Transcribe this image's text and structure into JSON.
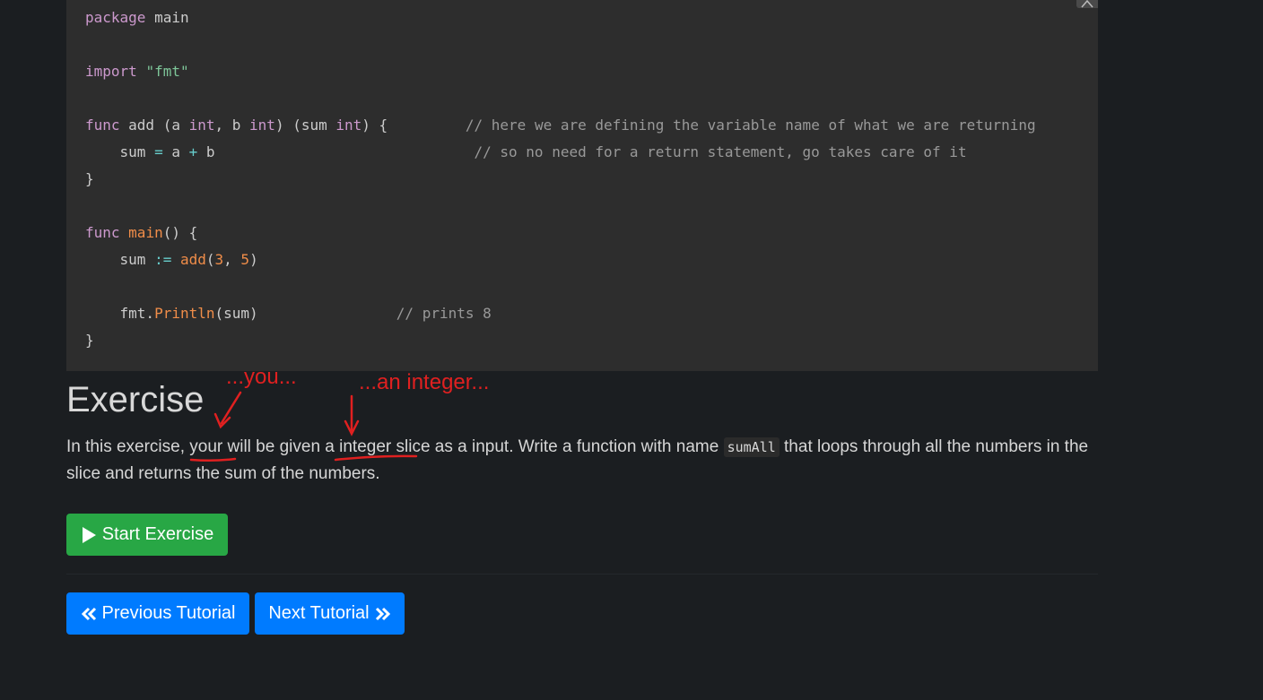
{
  "code": {
    "lines": [
      [
        {
          "t": "package",
          "c": "kw"
        },
        {
          "t": " main",
          "c": ""
        }
      ],
      [],
      [
        {
          "t": "import",
          "c": "kw"
        },
        {
          "t": " ",
          "c": ""
        },
        {
          "t": "\"fmt\"",
          "c": "str"
        }
      ],
      [],
      [
        {
          "t": "func",
          "c": "kw"
        },
        {
          "t": " add (a ",
          "c": ""
        },
        {
          "t": "int",
          "c": "type"
        },
        {
          "t": ", b ",
          "c": ""
        },
        {
          "t": "int",
          "c": "type"
        },
        {
          "t": ") (sum ",
          "c": ""
        },
        {
          "t": "int",
          "c": "type"
        },
        {
          "t": ") {         ",
          "c": ""
        },
        {
          "t": "// here we are defining the variable name of what we are returning",
          "c": "com"
        }
      ],
      [
        {
          "t": "    sum ",
          "c": ""
        },
        {
          "t": "=",
          "c": "op"
        },
        {
          "t": " a ",
          "c": ""
        },
        {
          "t": "+",
          "c": "op"
        },
        {
          "t": " b                              ",
          "c": ""
        },
        {
          "t": "// so no need for a return statement, go takes care of it",
          "c": "com"
        }
      ],
      [
        {
          "t": "}",
          "c": ""
        }
      ],
      [],
      [
        {
          "t": "func",
          "c": "kw"
        },
        {
          "t": " ",
          "c": ""
        },
        {
          "t": "main",
          "c": "fn"
        },
        {
          "t": "() {",
          "c": ""
        }
      ],
      [
        {
          "t": "    sum ",
          "c": ""
        },
        {
          "t": ":=",
          "c": "op"
        },
        {
          "t": " ",
          "c": ""
        },
        {
          "t": "add",
          "c": "fn"
        },
        {
          "t": "(",
          "c": ""
        },
        {
          "t": "3",
          "c": "num"
        },
        {
          "t": ", ",
          "c": ""
        },
        {
          "t": "5",
          "c": "num"
        },
        {
          "t": ")",
          "c": ""
        }
      ],
      [],
      [
        {
          "t": "    fmt.",
          "c": ""
        },
        {
          "t": "Println",
          "c": "fn"
        },
        {
          "t": "(sum)                ",
          "c": ""
        },
        {
          "t": "// prints 8",
          "c": "com"
        }
      ],
      [
        {
          "t": "}",
          "c": ""
        }
      ]
    ]
  },
  "exercise": {
    "title": "Exercise",
    "text_part1": "In this exercise, your will be given a integer slice as a input. Write a function with name ",
    "code_name": "sumAll",
    "text_part2": " that loops through all the numbers in the slice and returns the sum of the numbers."
  },
  "annotations": {
    "note1": "...you...",
    "note2": "...an integer...",
    "color": "#e02020"
  },
  "buttons": {
    "start": "Start Exercise",
    "prev": "Previous Tutorial",
    "next": "Next Tutorial"
  },
  "colors": {
    "background": "#1b1e21",
    "code_background": "#2d2d2d",
    "success": "#28a745",
    "primary": "#007bff"
  }
}
